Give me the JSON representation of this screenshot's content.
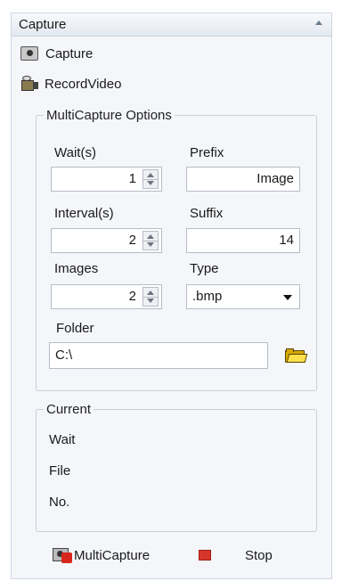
{
  "panel": {
    "title": "Capture",
    "actions": {
      "capture": "Capture",
      "record_video": "RecordVideo"
    }
  },
  "multicapture": {
    "legend": "MultiCapture Options",
    "wait": {
      "label": "Wait(s)",
      "value": "1"
    },
    "prefix": {
      "label": "Prefix",
      "value": "Image"
    },
    "interval": {
      "label": "Interval(s)",
      "value": "2"
    },
    "suffix": {
      "label": "Suffix",
      "value": "14"
    },
    "images": {
      "label": "Images",
      "value": "2"
    },
    "type": {
      "label": "Type",
      "value": ".bmp"
    },
    "folder": {
      "label": "Folder",
      "value": "C:\\"
    }
  },
  "current": {
    "legend": "Current",
    "items": [
      "Wait",
      "File",
      "No."
    ]
  },
  "buttons": {
    "multicapture": "MultiCapture",
    "stop": "Stop"
  },
  "icons": {
    "capture": "camera-icon",
    "record_video": "video-camera-icon",
    "folder": "folder-icon",
    "multicapture": "multicapture-icon",
    "stop": "stop-icon"
  },
  "colors": {
    "stop": "#d9362b",
    "folder": "#ffe04a"
  }
}
